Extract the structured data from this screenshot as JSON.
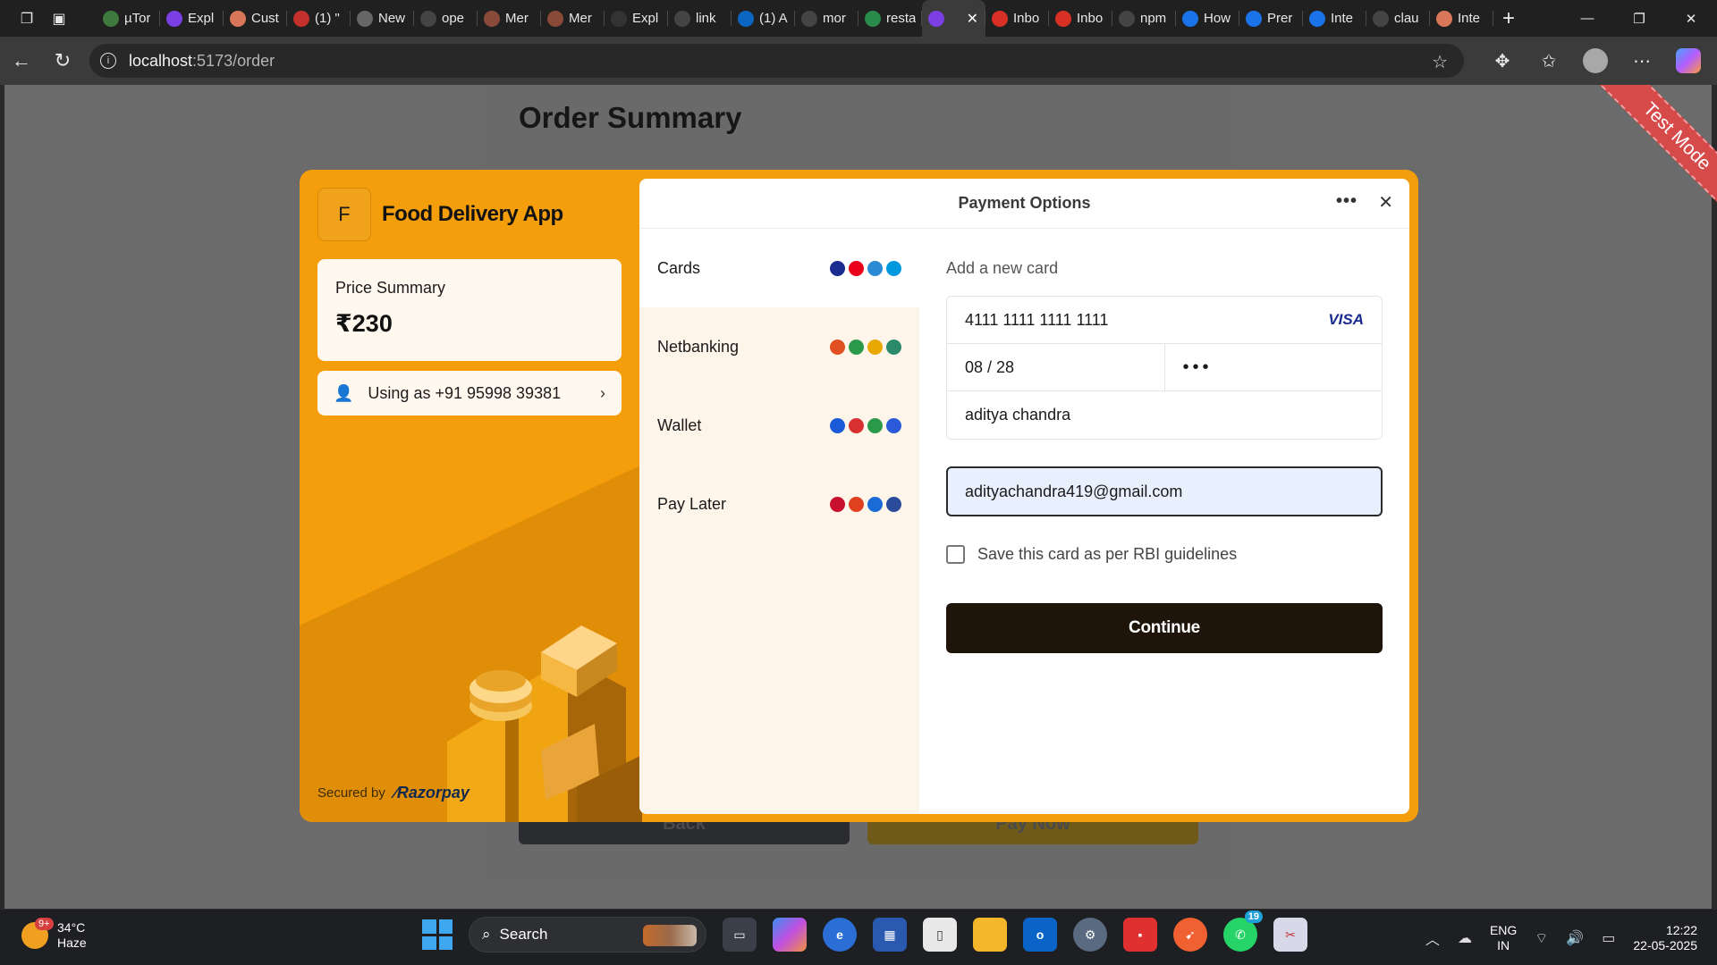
{
  "browser": {
    "tabs": [
      {
        "title": "µTor",
        "color": "#3e7a3e",
        "icon": "utorrent-icon"
      },
      {
        "title": "Expl",
        "color": "#7b3fe4",
        "icon": "vite-icon"
      },
      {
        "title": "Cust",
        "color": "#d9775b",
        "icon": "claude-icon"
      },
      {
        "title": "(1) \"",
        "color": "#c4302b",
        "icon": "youtube-icon"
      },
      {
        "title": "New",
        "color": "#666666",
        "icon": "newtab-icon"
      },
      {
        "title": "ope",
        "color": "#444444",
        "icon": "search-icon"
      },
      {
        "title": "Mer",
        "color": "#8a4a3a",
        "icon": "site-icon"
      },
      {
        "title": "Mer",
        "color": "#8a4a3a",
        "icon": "site-icon"
      },
      {
        "title": "Expl",
        "color": "#333333",
        "icon": "github-icon"
      },
      {
        "title": "link",
        "color": "#444444",
        "icon": "search-icon"
      },
      {
        "title": "(1) A",
        "color": "#0a66c2",
        "icon": "linkedin-icon"
      },
      {
        "title": "mor",
        "color": "#444444",
        "icon": "search-icon"
      },
      {
        "title": "resta",
        "color": "#2a8a4a",
        "icon": "leaf-icon"
      },
      {
        "title": "",
        "color": "#7b3fe4",
        "icon": "vite-icon",
        "active": true
      },
      {
        "title": "Inbo",
        "color": "#d93025",
        "icon": "gmail-icon"
      },
      {
        "title": "Inbo",
        "color": "#d93025",
        "icon": "gmail-icon"
      },
      {
        "title": "npm",
        "color": "#444444",
        "icon": "search-icon"
      },
      {
        "title": "How",
        "color": "#1a73e8",
        "icon": "perplexity-icon"
      },
      {
        "title": "Prer",
        "color": "#1a73e8",
        "icon": "perplexity-icon"
      },
      {
        "title": "Inte",
        "color": "#1a73e8",
        "icon": "perplexity-icon"
      },
      {
        "title": "clau",
        "color": "#444444",
        "icon": "search-icon"
      },
      {
        "title": "Inte",
        "color": "#d9775b",
        "icon": "claude-icon"
      }
    ],
    "url_host": "localhost",
    "url_path": ":5173/order"
  },
  "page": {
    "title": "Order Summary",
    "back_label": "Back",
    "pay_label": "Pay Now",
    "ribbon": "Test Mode"
  },
  "checkout": {
    "merchant_initial": "F",
    "merchant_name": "Food Delivery App",
    "price_label": "Price Summary",
    "price_value": "₹230",
    "user_label": "Using as +91 95998 39381",
    "secured_by": "Secured by",
    "brand": "Razorpay",
    "panel_title": "Payment Options",
    "methods": [
      {
        "label": "Cards",
        "icons": [
          "#1a2c8f",
          "#eb001b",
          "#2a8ad4",
          "#0099df"
        ]
      },
      {
        "label": "Netbanking",
        "icons": [
          "#e05020",
          "#2a9a4a",
          "#e8a800",
          "#2a8a6a"
        ]
      },
      {
        "label": "Wallet",
        "icons": [
          "#1a5ad8",
          "#d83030",
          "#2a9a4a",
          "#2a5ad8"
        ]
      },
      {
        "label": "Pay Later",
        "icons": [
          "#c8102e",
          "#e04020",
          "#1a6ad8",
          "#2a4a9a"
        ]
      }
    ],
    "form_title": "Add a new card",
    "card_number": "4111 1111 1111 1111",
    "card_brand": "VISA",
    "expiry": "08 / 28",
    "cvv": "•••",
    "name": "aditya chandra",
    "email": "adityachandra419@gmail.com",
    "save_label": "Save this card as per RBI guidelines",
    "continue_label": "Continue"
  },
  "taskbar": {
    "weather_badge": "9+",
    "temp": "34°C",
    "condition": "Haze",
    "search_placeholder": "Search",
    "whatsapp_badge": "19",
    "lang1": "ENG",
    "lang2": "IN",
    "time": "12:22",
    "date": "22-05-2025"
  }
}
